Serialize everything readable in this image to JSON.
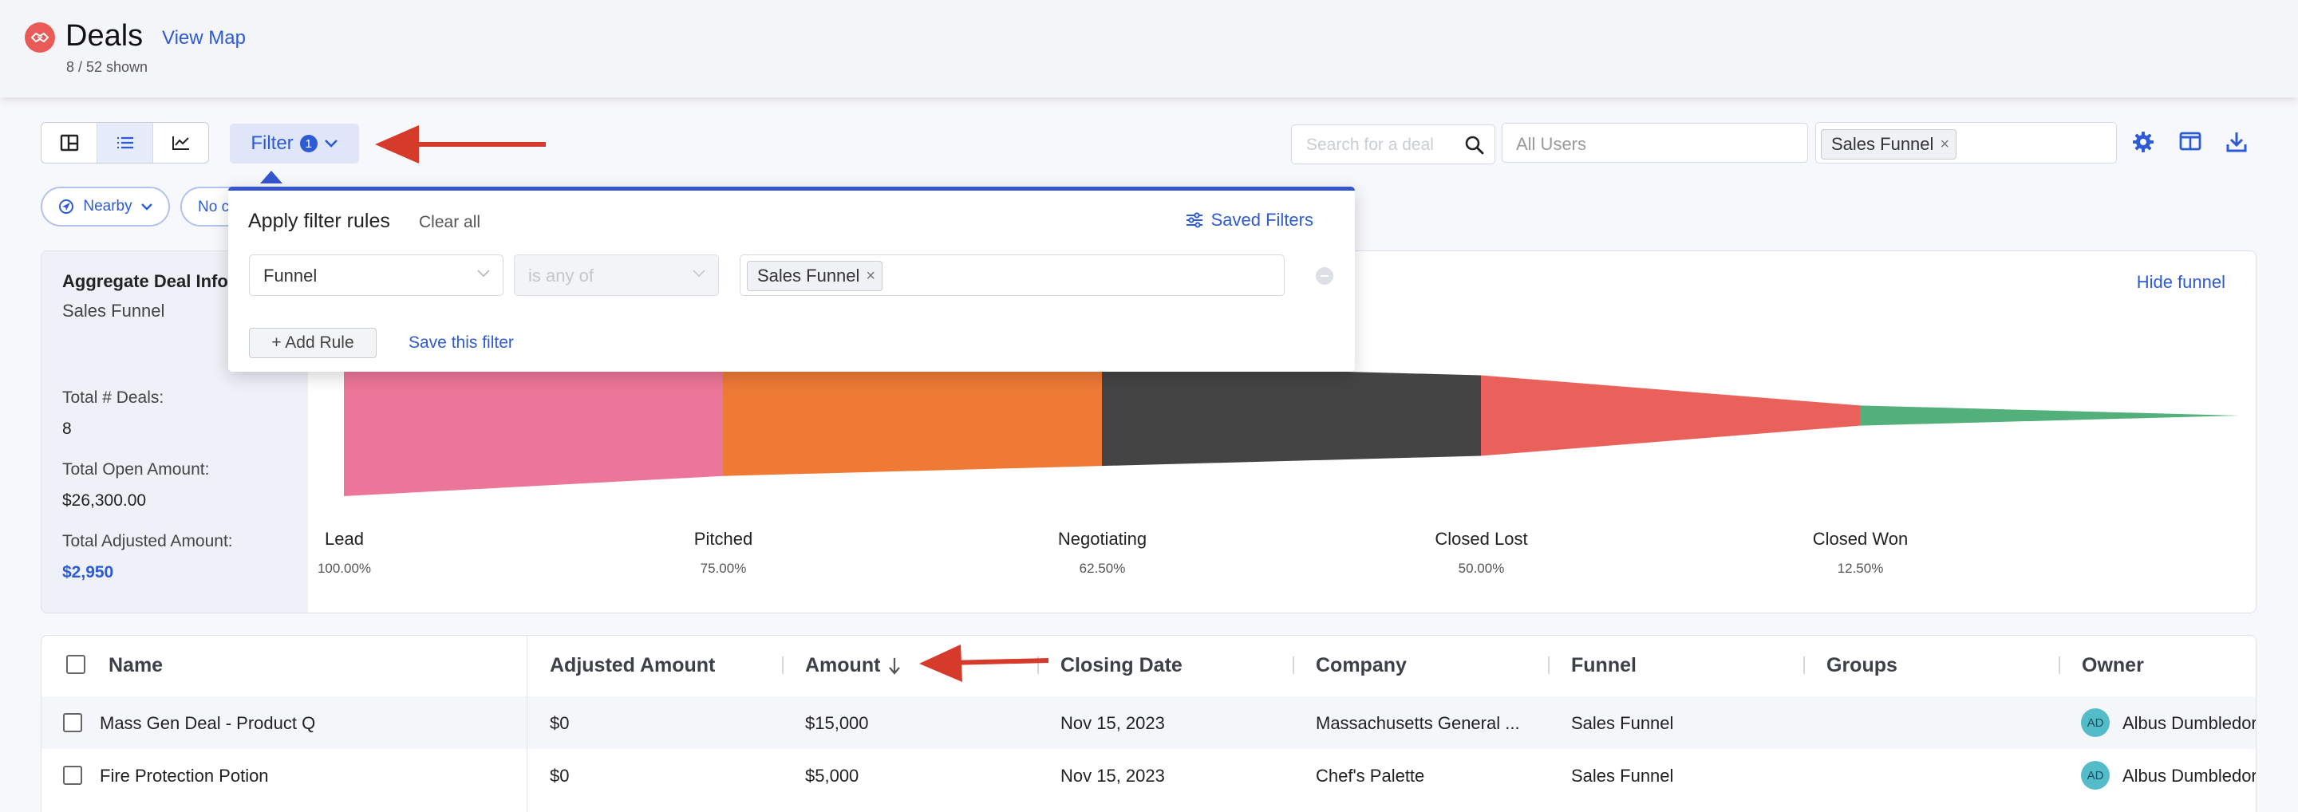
{
  "header": {
    "title": "Deals",
    "view_map": "View Map",
    "shown": "8 / 52 shown"
  },
  "toolbar": {
    "filter_label": "Filter",
    "filter_count": "1",
    "search_placeholder": "Search for a deal",
    "users_placeholder": "All Users",
    "funnel_chip": "Sales Funnel",
    "chip_close": "×"
  },
  "quick_filters": {
    "nearby": "Nearby",
    "no_c": "No c"
  },
  "aggregate": {
    "title": "Aggregate Deal Infor",
    "subtitle": "Sales Funnel",
    "total_deals_label": "Total # Deals:",
    "total_deals_value": "8",
    "open_amount_label": "Total Open Amount:",
    "open_amount_value": "$26,300.00",
    "adjusted_amount_label": "Total Adjusted Amount:",
    "adjusted_amount_value": "$2,950",
    "hide_funnel": "Hide funnel"
  },
  "funnel": {
    "stages": [
      {
        "name": "Lead",
        "pct": "100.00%",
        "value": 1.0,
        "color": "#ec7699"
      },
      {
        "name": "Pitched",
        "pct": "75.00%",
        "value": 0.75,
        "color": "#ee7a36"
      },
      {
        "name": "Negotiating",
        "pct": "62.50%",
        "value": 0.625,
        "color": "#444444"
      },
      {
        "name": "Closed Lost",
        "pct": "50.00%",
        "value": 0.5,
        "color": "#ea615b"
      },
      {
        "name": "Closed Won",
        "pct": "12.50%",
        "value": 0.125,
        "color": "#54b07a"
      }
    ]
  },
  "filter_popover": {
    "title": "Apply filter rules",
    "clear_all": "Clear all",
    "saved_filters": "Saved Filters",
    "field": "Funnel",
    "operator": "is any of",
    "value_chip": "Sales Funnel",
    "add_rule": "+ Add Rule",
    "save_filter": "Save this filter"
  },
  "table": {
    "columns": [
      "Name",
      "Adjusted Amount",
      "Amount",
      "Closing Date",
      "Company",
      "Funnel",
      "Groups",
      "Owner"
    ],
    "rows": [
      {
        "name": "Mass Gen Deal - Product Q",
        "adjusted": "$0",
        "amount": "$15,000",
        "closing": "Nov 15, 2023",
        "company": "Massachusetts General ...",
        "funnel": "Sales Funnel",
        "groups": "",
        "owner_initials": "AD",
        "owner": "Albus Dumbledore"
      },
      {
        "name": "Fire Protection Potion",
        "adjusted": "$0",
        "amount": "$5,000",
        "closing": "Nov 15, 2023",
        "company": "Chef's Palette",
        "funnel": "Sales Funnel",
        "groups": "",
        "owner_initials": "AD",
        "owner": "Albus Dumbledore"
      }
    ]
  },
  "colors": {
    "accent": "#2d5bd6",
    "arrow": "#d53a2a",
    "logo": "#ea5a57"
  }
}
